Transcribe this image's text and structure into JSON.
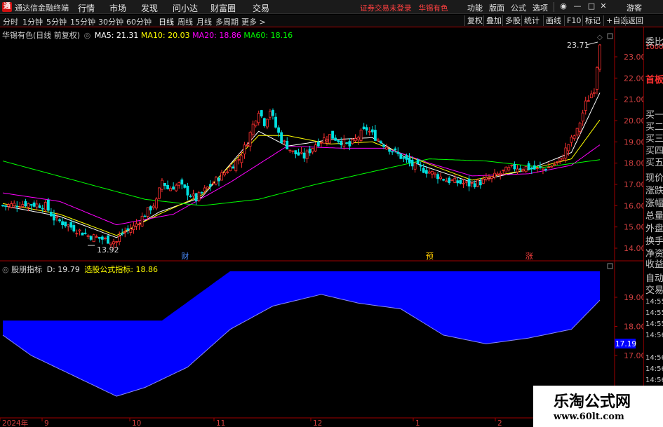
{
  "titlebar": {
    "app_name": "通达信金融终端",
    "menus": [
      "行情",
      "市场",
      "发现",
      "问小达",
      "财富圈",
      "交易"
    ],
    "notice": "证券交易未登录",
    "stock_name": "华锡有色",
    "right_menus": [
      "功能",
      "版面",
      "公式",
      "选项"
    ],
    "guest": "游客"
  },
  "toolbar": {
    "periods": [
      "分时",
      "1分钟",
      "5分钟",
      "15分钟",
      "30分钟",
      "60分钟",
      "日线",
      "周线",
      "月线",
      "多周期",
      "更多"
    ],
    "active_period": "日线",
    "right_buttons": [
      "复权",
      "叠加",
      "多股",
      "统计",
      "画线",
      "F10",
      "标记",
      "+自选",
      "返回"
    ]
  },
  "main_pane": {
    "title": "华锡有色(日线 前复权)",
    "ma": [
      {
        "label": "MA5: 21.31",
        "color": "#ffffff"
      },
      {
        "label": "MA10: 20.03",
        "color": "#ffff00"
      },
      {
        "label": "MA20: 18.86",
        "color": "#ff00ff"
      },
      {
        "label": "MA60: 18.16",
        "color": "#00ff00"
      }
    ],
    "markers": [
      {
        "text": "财",
        "date_index": 64,
        "color": "#4a8cff"
      },
      {
        "text": "预",
        "date_index": 150,
        "color": "#ffcc00"
      },
      {
        "text": "涨",
        "date_index": 185,
        "color": "#ff4040"
      }
    ]
  },
  "indicator_pane": {
    "name": "股朋指标",
    "d_label": "D: 19.79",
    "formula_label": "选股公式指标: 18.86",
    "current_value": "17.19"
  },
  "right_panel": {
    "labels": [
      "委比",
      "首板",
      "买一",
      "买二",
      "买三",
      "买四",
      "买五",
      "现价",
      "涨跌",
      "涨幅",
      "总量",
      "外盘",
      "换手",
      "净资",
      "收益",
      "自动",
      "交易"
    ],
    "times": [
      "14:55",
      "14:55",
      "14:55",
      "14:56",
      "14:56",
      "14:56",
      "14:56"
    ],
    "code": "1000"
  },
  "xaxis_labels": [
    "2024年",
    "9",
    "10",
    "11",
    "12",
    "1",
    "2"
  ],
  "watermark": {
    "line1": "乐淘公式网",
    "line2": "www.60lt.com"
  },
  "chart_data": [
    {
      "type": "candlestick",
      "title": "华锡有色(日线 前复权)",
      "y_ticks": [
        14.0,
        15.0,
        16.0,
        17.0,
        18.0,
        19.0,
        20.0,
        21.0,
        22.0,
        23.0
      ],
      "ylim": [
        13.5,
        24.0
      ],
      "annotations": [
        {
          "text": "13.92",
          "kind": "low"
        },
        {
          "text": "23.71",
          "kind": "high"
        }
      ],
      "close_path": [
        [
          0,
          16.0
        ],
        [
          8,
          16.1
        ],
        [
          15,
          16.0
        ],
        [
          18,
          15.4
        ],
        [
          24,
          15.0
        ],
        [
          30,
          14.6
        ],
        [
          36,
          14.4
        ],
        [
          40,
          14.3
        ],
        [
          42,
          14.7
        ],
        [
          46,
          15.0
        ],
        [
          50,
          15.6
        ],
        [
          54,
          16.2
        ],
        [
          56,
          17.2
        ],
        [
          58,
          16.8
        ],
        [
          62,
          17.0
        ],
        [
          66,
          16.5
        ],
        [
          68,
          16.3
        ],
        [
          70,
          16.6
        ],
        [
          75,
          17.2
        ],
        [
          80,
          17.8
        ],
        [
          83,
          18.2
        ],
        [
          86,
          19.0
        ],
        [
          88,
          19.8
        ],
        [
          90,
          20.5
        ],
        [
          92,
          19.9
        ],
        [
          94,
          20.5
        ],
        [
          96,
          19.7
        ],
        [
          98,
          19.1
        ],
        [
          102,
          18.5
        ],
        [
          106,
          18.3
        ],
        [
          110,
          18.9
        ],
        [
          115,
          19.3
        ],
        [
          118,
          19.1
        ],
        [
          122,
          18.8
        ],
        [
          126,
          19.4
        ],
        [
          128,
          19.6
        ],
        [
          132,
          19.1
        ],
        [
          136,
          18.7
        ],
        [
          140,
          18.3
        ],
        [
          144,
          17.9
        ],
        [
          150,
          17.6
        ],
        [
          156,
          17.2
        ],
        [
          160,
          17.1
        ],
        [
          164,
          17.0
        ],
        [
          168,
          17.1
        ],
        [
          172,
          17.3
        ],
        [
          176,
          17.6
        ],
        [
          180,
          17.8
        ],
        [
          184,
          17.8
        ],
        [
          188,
          17.7
        ],
        [
          192,
          17.8
        ],
        [
          196,
          18.1
        ],
        [
          199,
          18.9
        ],
        [
          202,
          19.5
        ],
        [
          205,
          20.8
        ],
        [
          208,
          21.5
        ],
        [
          210,
          23.71
        ]
      ],
      "ma_paths": {
        "MA5": [
          [
            0,
            16.0
          ],
          [
            20,
            15.5
          ],
          [
            40,
            14.5
          ],
          [
            55,
            15.7
          ],
          [
            70,
            16.4
          ],
          [
            90,
            19.5
          ],
          [
            100,
            18.8
          ],
          [
            115,
            19.1
          ],
          [
            130,
            19.2
          ],
          [
            145,
            18.0
          ],
          [
            165,
            17.1
          ],
          [
            185,
            17.7
          ],
          [
            200,
            18.5
          ],
          [
            210,
            21.31
          ]
        ],
        "MA10": [
          [
            0,
            16.1
          ],
          [
            20,
            15.6
          ],
          [
            40,
            14.6
          ],
          [
            55,
            15.6
          ],
          [
            70,
            16.5
          ],
          [
            90,
            19.3
          ],
          [
            100,
            19.3
          ],
          [
            115,
            18.9
          ],
          [
            130,
            19.0
          ],
          [
            145,
            18.2
          ],
          [
            165,
            17.2
          ],
          [
            185,
            17.7
          ],
          [
            200,
            18.2
          ],
          [
            210,
            20.03
          ]
        ],
        "MA20": [
          [
            0,
            16.6
          ],
          [
            20,
            16.2
          ],
          [
            40,
            15.1
          ],
          [
            60,
            15.6
          ],
          [
            80,
            17.1
          ],
          [
            100,
            18.8
          ],
          [
            120,
            18.7
          ],
          [
            135,
            18.7
          ],
          [
            150,
            18.0
          ],
          [
            165,
            17.4
          ],
          [
            185,
            17.5
          ],
          [
            200,
            17.9
          ],
          [
            210,
            18.86
          ]
        ],
        "MA60": [
          [
            0,
            18.1
          ],
          [
            25,
            17.2
          ],
          [
            50,
            16.3
          ],
          [
            70,
            16.0
          ],
          [
            90,
            16.3
          ],
          [
            110,
            17.0
          ],
          [
            130,
            17.6
          ],
          [
            150,
            18.2
          ],
          [
            170,
            18.1
          ],
          [
            190,
            17.8
          ],
          [
            210,
            18.16
          ]
        ]
      }
    },
    {
      "type": "area",
      "title": "股朋指标",
      "y_ticks": [
        17.0,
        18.0,
        19.0
      ],
      "series": [
        {
          "name": "D",
          "color": "#0000ff"
        }
      ],
      "upper_path": [
        [
          0,
          18.2
        ],
        [
          56,
          18.2
        ],
        [
          80,
          19.9
        ],
        [
          100,
          19.9
        ],
        [
          210,
          19.9
        ]
      ],
      "lower_path": [
        [
          0,
          17.7
        ],
        [
          10,
          17.0
        ],
        [
          25,
          16.3
        ],
        [
          40,
          15.6
        ],
        [
          50,
          15.9
        ],
        [
          65,
          16.6
        ],
        [
          80,
          17.9
        ],
        [
          95,
          18.7
        ],
        [
          112,
          19.1
        ],
        [
          125,
          18.8
        ],
        [
          140,
          18.6
        ],
        [
          155,
          17.7
        ],
        [
          170,
          17.4
        ],
        [
          185,
          17.6
        ],
        [
          200,
          17.9
        ],
        [
          210,
          18.9
        ]
      ]
    }
  ]
}
